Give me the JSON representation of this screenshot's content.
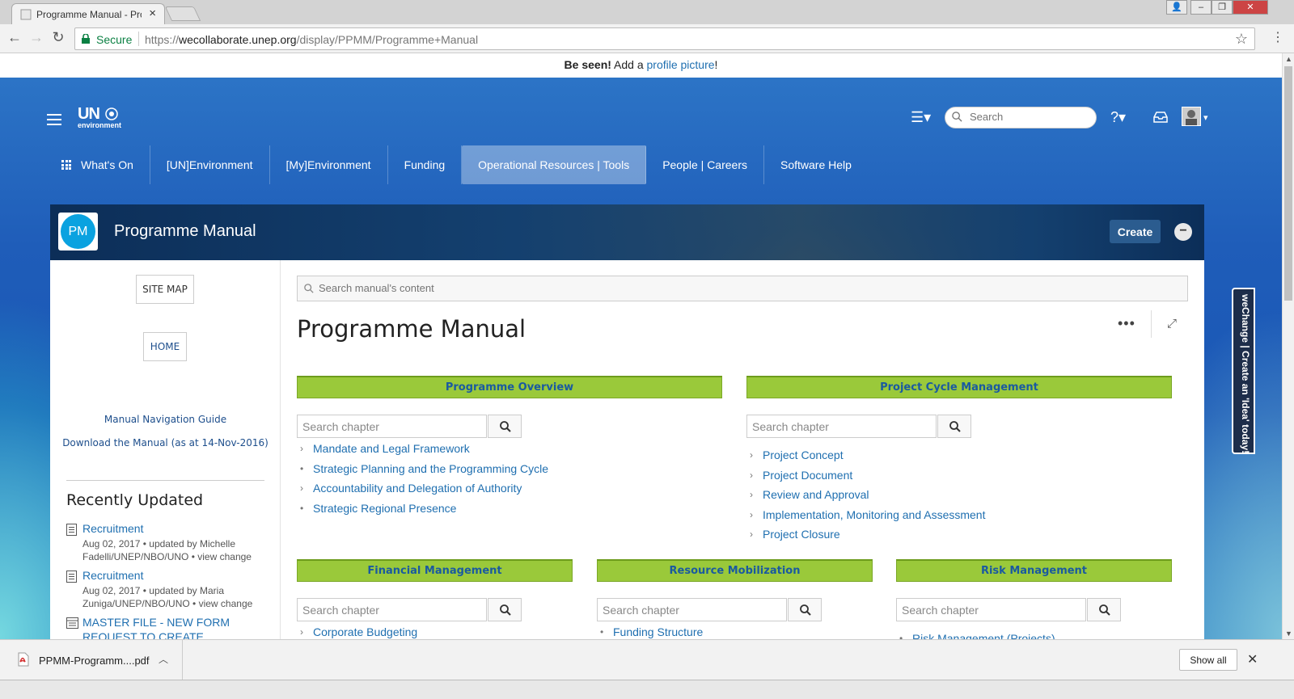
{
  "browser": {
    "tab_title": "Programme Manual - Pro",
    "secure_label": "Secure",
    "url_scheme": "https://",
    "url_host": "wecollaborate.unep.org",
    "url_path": "/display/PPMM/Programme+Manual"
  },
  "notice": {
    "bold": "Be seen!",
    "text": " Add a ",
    "link": "profile picture",
    "end": "!"
  },
  "header": {
    "logo_main": "UN",
    "logo_sub": "environment",
    "search_placeholder": "Search"
  },
  "topnav": [
    {
      "label": "What's On"
    },
    {
      "label": "[UN]Environment"
    },
    {
      "label": "[My]Environment"
    },
    {
      "label": "Funding"
    },
    {
      "label": "Operational Resources | Tools",
      "active": true
    },
    {
      "label": "People | Careers"
    },
    {
      "label": "Software Help"
    }
  ],
  "space": {
    "badge": "PM",
    "title": "Programme Manual",
    "create_label": "Create",
    "collapse_label": "−"
  },
  "sidebar": {
    "sitemap_label": "SITE MAP",
    "home_label": "HOME",
    "nav_guide": "Manual Navigation Guide",
    "download": "Download the Manual (as at 14-Nov-2016)",
    "recent_title": "Recently Updated",
    "recent": [
      {
        "title": "Recruitment",
        "meta": "Aug 02, 2017 • updated by Michelle Fadelli/UNEP/NBO/UNO •",
        "view": "view change"
      },
      {
        "title": "Recruitment",
        "meta": "Aug 02, 2017 • updated by Maria Zuniga/UNEP/NBO/UNO •",
        "view": "view change"
      },
      {
        "title": "MASTER FILE - NEW FORM REQUEST TO CREATE",
        "meta": "",
        "view": ""
      }
    ]
  },
  "main": {
    "search_placeholder": "Search manual's content",
    "page_title": "Programme Manual",
    "more_label": "•••",
    "expand_label": "⤢",
    "chapter_placeholder": "Search chapter",
    "sections": [
      {
        "title": "Programme Overview",
        "items": [
          {
            "text": "Mandate and Legal Framework",
            "bullet": "›"
          },
          {
            "text": "Strategic Planning and the Programming Cycle",
            "bullet": "•"
          },
          {
            "text": "Accountability and Delegation of Authority",
            "bullet": "›"
          },
          {
            "text": "Strategic Regional Presence",
            "bullet": "•"
          }
        ]
      },
      {
        "title": "Project Cycle Management",
        "items": [
          {
            "text": "Project Concept",
            "bullet": "›"
          },
          {
            "text": "Project Document",
            "bullet": "›"
          },
          {
            "text": "Review and Approval",
            "bullet": "›"
          },
          {
            "text": "Implementation, Monitoring and Assessment",
            "bullet": "›"
          },
          {
            "text": "Project Closure",
            "bullet": "›"
          }
        ]
      },
      {
        "title": "Financial Management",
        "items": [
          {
            "text": "Corporate Budgeting",
            "bullet": "›"
          }
        ]
      },
      {
        "title": "Resource Mobilization",
        "items": [
          {
            "text": "Funding Structure",
            "bullet": "•"
          }
        ]
      },
      {
        "title": "Risk Management",
        "items": [
          {
            "text": "Risk Management (Projects)",
            "bullet": "•"
          }
        ]
      }
    ]
  },
  "wechange": "weChange | Create an 'Idea' today!",
  "downloads": {
    "file": "PPMM-Programm....pdf",
    "show_all": "Show all"
  }
}
